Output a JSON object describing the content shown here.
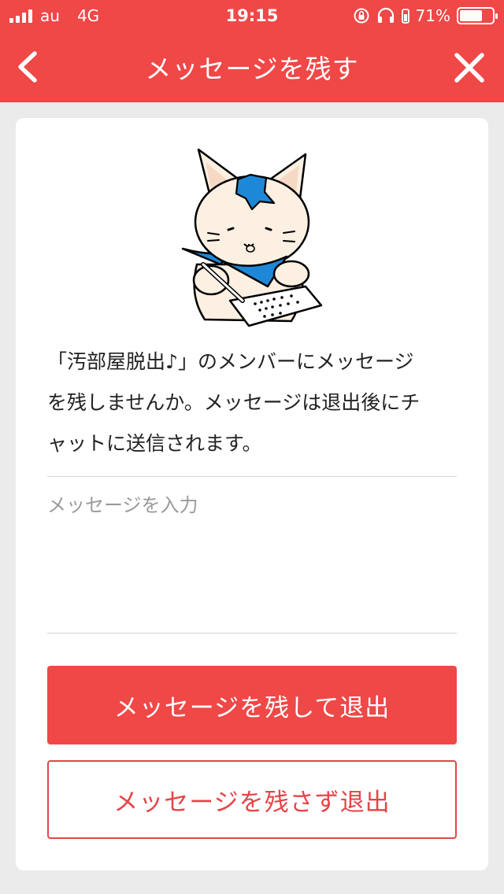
{
  "status_bar": {
    "carrier": "au",
    "network": "4G",
    "time": "19:15",
    "battery": "71%",
    "battery_level": 0.71
  },
  "nav": {
    "title": "メッセージを残す",
    "back_icon": "chevron-left-icon",
    "close_icon": "close-icon"
  },
  "content": {
    "illustration": "cat-writing-letter-illustration",
    "description_lines": [
      "「汚部屋脱出♪」のメンバーにメッセージ",
      "を残しませんか。メッセージは退出後にチ",
      "ャットに送信されます。"
    ],
    "message_input": {
      "placeholder": "メッセージを入力",
      "value": ""
    }
  },
  "actions": {
    "leave_with_message": "メッセージを残して退出",
    "leave_without_message": "メッセージを残さず退出"
  },
  "colors": {
    "accent": "#f04747",
    "secondary_text": "#e64448",
    "background": "#ebebeb"
  }
}
